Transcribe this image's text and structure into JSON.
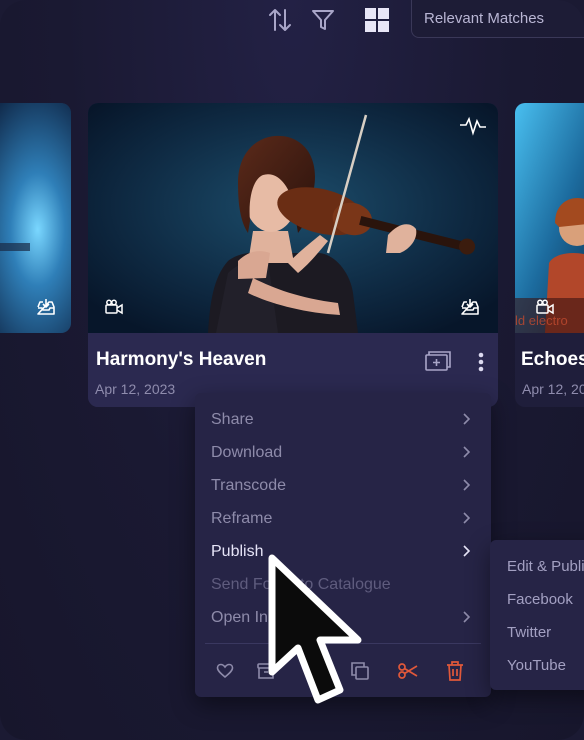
{
  "toolbar": {
    "sort_icon": "sort-arrows-icon",
    "filter_icon": "filter-icon",
    "view_icon": "grid-view-icon",
    "sort_by": "Relevant Matches"
  },
  "cards": {
    "main": {
      "title": "Harmony's Heaven",
      "date": "Apr 12, 2023"
    },
    "right": {
      "title": "Echoes",
      "date": "Apr 12, 20",
      "background_text": "ld electro"
    }
  },
  "menu": {
    "items": [
      {
        "label": "Share"
      },
      {
        "label": "Download"
      },
      {
        "label": "Transcode"
      },
      {
        "label": "Reframe"
      },
      {
        "label": "Publish"
      },
      {
        "label": "Send For Auto Catalogue"
      },
      {
        "label": "Open In"
      }
    ],
    "actions": [
      "heart-icon",
      "archive-icon",
      "duplicate-icon",
      "scissors-icon",
      "trash-icon"
    ]
  },
  "submenu": {
    "items": [
      {
        "label": "Edit & Publish"
      },
      {
        "label": "Facebook"
      },
      {
        "label": "Twitter"
      },
      {
        "label": "YouTube"
      }
    ]
  },
  "colors": {
    "background": "#1b1a33",
    "card": "#2b2950",
    "menu": "#262446",
    "danger": "#e0583a",
    "text_primary": "#ffffff",
    "text_muted": "#8e8baa"
  }
}
